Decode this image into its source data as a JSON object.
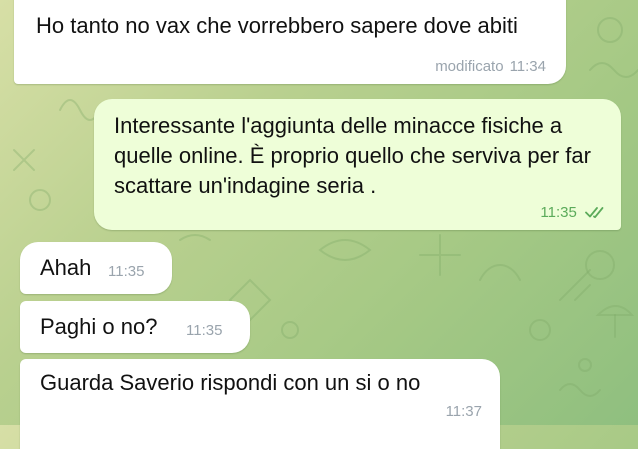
{
  "theme": {
    "incoming_bubble_color": "#ffffff",
    "outgoing_bubble_color": "#eefed8",
    "incoming_meta_color": "#9aa4ad",
    "outgoing_meta_color": "#5bab5a"
  },
  "messages": [
    {
      "direction": "incoming",
      "text": "Ho tanto no vax che vorrebbero sapere dove abiti",
      "edited_label": "modificato",
      "time": "11:34"
    },
    {
      "direction": "outgoing",
      "text": "Interessante l'aggiunta delle minacce fisiche a quelle online. È proprio quello che serviva per far scattare un'indagine seria .",
      "time": "11:35",
      "status_icon": "double-check-icon"
    },
    {
      "direction": "incoming",
      "text": "Ahah",
      "time": "11:35"
    },
    {
      "direction": "incoming",
      "text": "Paghi o no?",
      "time": "11:35"
    },
    {
      "direction": "incoming",
      "text": "Guarda Saverio rispondi con un si o no",
      "time": "11:37"
    }
  ]
}
